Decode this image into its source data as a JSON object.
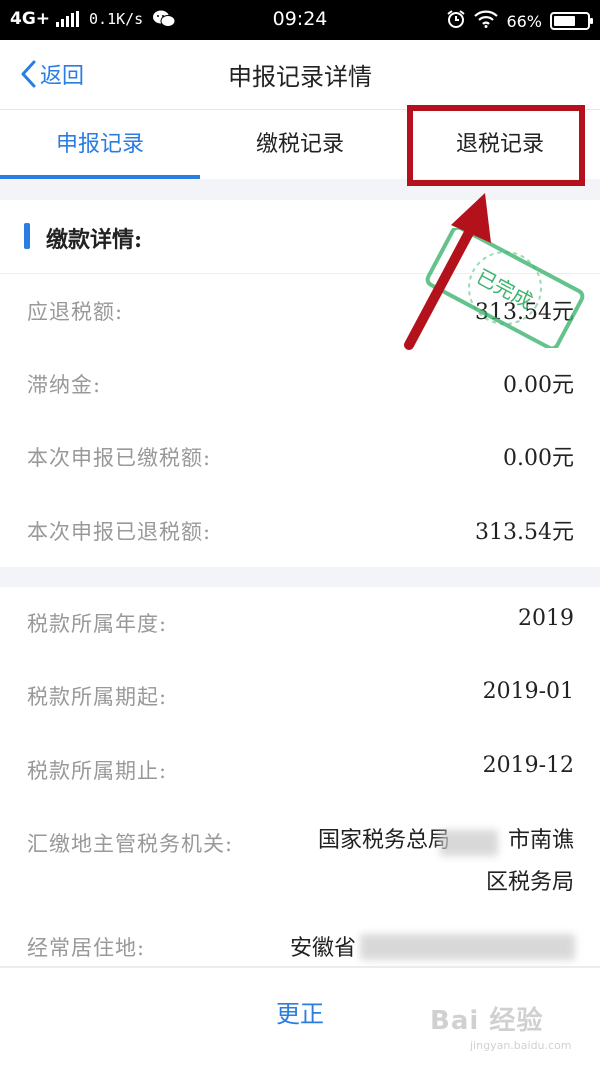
{
  "status_bar": {
    "network": "4G+",
    "speed": "0.1K/s",
    "time": "09:24",
    "battery": "66%",
    "battery_level": 0.66,
    "icons": [
      "signal-icon",
      "wechat-icon",
      "alarm-icon",
      "wifi-icon",
      "battery-icon"
    ]
  },
  "nav": {
    "back_label": "返回",
    "title": "申报记录详情"
  },
  "tabs": [
    {
      "label": "申报记录",
      "active": true
    },
    {
      "label": "缴税记录",
      "active": false
    },
    {
      "label": "退税记录",
      "active": false
    }
  ],
  "section": {
    "title": "缴款详情:"
  },
  "payment_rows": [
    {
      "label": "应退税额:",
      "value": "313.54元"
    },
    {
      "label": "滞纳金:",
      "value": "0.00元"
    },
    {
      "label": "本次申报已缴税额:",
      "value": "0.00元"
    },
    {
      "label": "本次申报已退税额:",
      "value": "313.54元"
    }
  ],
  "info_rows": [
    {
      "label": "税款所属年度:",
      "value": "2019"
    },
    {
      "label": "税款所属期起:",
      "value": "2019-01"
    },
    {
      "label": "税款所属期止:",
      "value": "2019-12"
    },
    {
      "label": "汇缴地主管税务机关:",
      "value_line1": "国家税务总局",
      "value_line1_tail": "市南谯",
      "value_line2": "区税务局"
    },
    {
      "label": "经常居住地:",
      "value": "安徽省"
    }
  ],
  "stamp": {
    "text": "已完成",
    "color": "#3cb46e"
  },
  "bottom": {
    "button_label": "更正"
  },
  "watermark": {
    "main": "Bai 经验",
    "sub": "jingyan.baidu.com"
  },
  "colors": {
    "accent": "#2a7de1",
    "annotation": "#b3121c",
    "gap": "#f3f4f8"
  }
}
